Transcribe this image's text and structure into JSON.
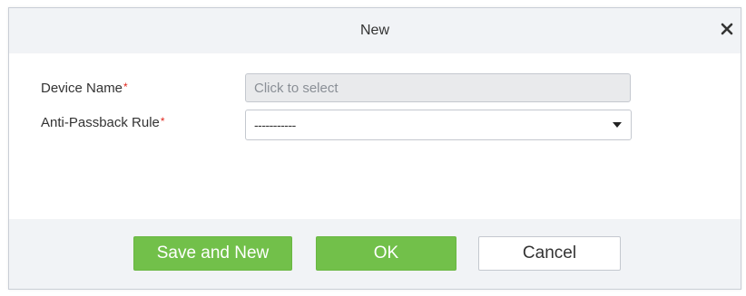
{
  "dialog": {
    "title": "New",
    "close_icon": "close-icon"
  },
  "form": {
    "device_name": {
      "label": "Device Name",
      "required_mark": "*",
      "placeholder": "Click to select",
      "value": ""
    },
    "anti_passback_rule": {
      "label": "Anti-Passback Rule",
      "required_mark": "*",
      "selected_value": "-----------",
      "dropdown_icon": "chevron-down-icon"
    }
  },
  "footer": {
    "save_and_new_label": "Save and New",
    "ok_label": "OK",
    "cancel_label": "Cancel"
  },
  "colors": {
    "primary_button": "#72c04a",
    "required_asterisk": "#e1261c",
    "header_footer_bg": "#f1f3f6"
  }
}
